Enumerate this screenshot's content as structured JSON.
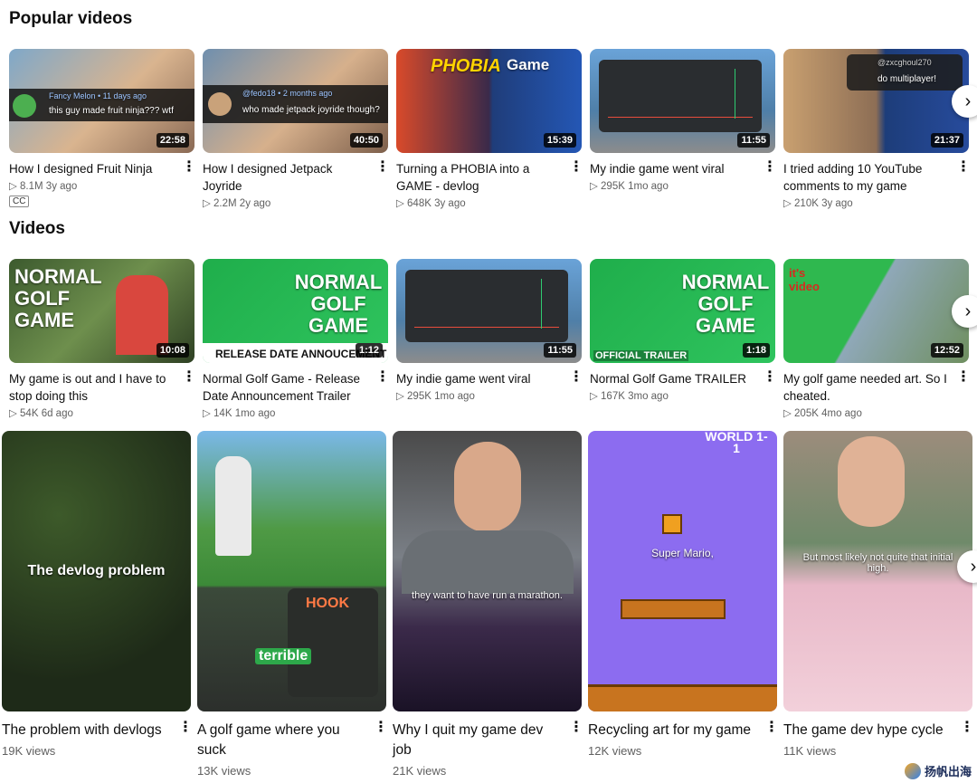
{
  "sections": {
    "popular_title": "Popular videos",
    "videos_title": "Videos"
  },
  "popular": [
    {
      "title": "How I designed Fruit Ninja",
      "stats": "▷ 8.1M  3y ago",
      "duration": "22:58",
      "cc": "CC",
      "thumb_text": "this guy made fruit ninja??? wtf",
      "thumb_user": "Fancy Melon • 11 days ago"
    },
    {
      "title": "How I designed Jetpack Joyride",
      "stats": "▷ 2.2M  2y ago",
      "duration": "40:50",
      "thumb_text": "who made jetpack joyride though?",
      "thumb_user": "@fedo18 • 2 months ago"
    },
    {
      "title": "Turning a PHOBIA into a GAME - devlog",
      "stats": "▷ 648K  3y ago",
      "duration": "15:39",
      "thumb_text_a": "PHOBIA",
      "thumb_text_b": "Game"
    },
    {
      "title": "My indie game went viral",
      "stats": "▷ 295K  1mo ago",
      "duration": "11:55"
    },
    {
      "title": "I tried adding 10 YouTube comments to my game",
      "stats": "▷ 210K  3y ago",
      "duration": "21:37",
      "thumb_text": "do multiplayer!",
      "thumb_user": "@zxcghoul270"
    }
  ],
  "videos": [
    {
      "title": "My game is out and I have to stop doing this",
      "stats": "▷ 54K  6d ago",
      "duration": "10:08",
      "thumb_text": "NORMAL GOLF GAME"
    },
    {
      "title": "Normal Golf Game - Release Date Announcement Trailer",
      "stats": "▷ 14K  1mo ago",
      "duration": "1:12",
      "thumb_text": "NORMAL GOLF GAME",
      "thumb_banner": "RELEASE DATE ANNOUCEMENT"
    },
    {
      "title": "My indie game went viral",
      "stats": "▷ 295K  1mo ago",
      "duration": "11:55"
    },
    {
      "title": "Normal Golf Game TRAILER",
      "stats": "▷ 167K  3mo ago",
      "duration": "1:18",
      "thumb_text": "NORMAL GOLF GAME",
      "thumb_banner": "OFFICIAL TRAILER"
    },
    {
      "title": "My golf game needed art. So I cheated.",
      "stats": "▷ 205K  4mo ago",
      "duration": "12:52",
      "thumb_text": "it's video"
    }
  ],
  "shorts": [
    {
      "title": "The problem with devlogs",
      "views": "19K views",
      "caption": "The devlog problem"
    },
    {
      "title": "A golf game where you suck",
      "views": "13K views",
      "caption": "terrible",
      "caption_b": "HOOK"
    },
    {
      "title": "Why I quit my game dev job",
      "views": "21K views",
      "caption": "they want to have run a marathon."
    },
    {
      "title": "Recycling art for my game",
      "views": "12K views",
      "caption": "Super Mario,",
      "caption_b": "WORLD 1-1"
    },
    {
      "title": "The game dev hype cycle",
      "views": "11K views",
      "caption": "But most likely not quite that initial high."
    }
  ],
  "icons": {
    "kebab": "⋮",
    "next": "›"
  },
  "watermark": "扬帆出海"
}
